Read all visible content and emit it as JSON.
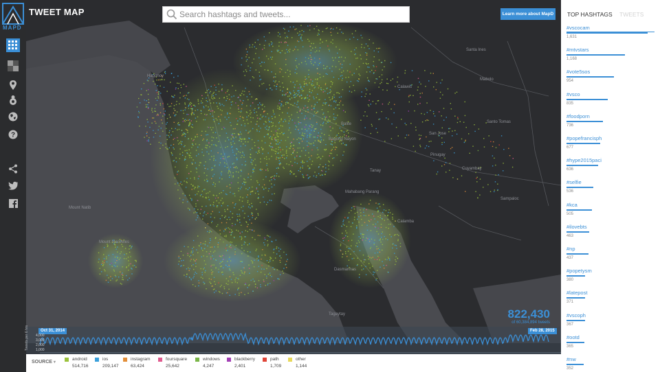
{
  "app": {
    "title": "TWEET MAP",
    "logo_text": "MAPD"
  },
  "search": {
    "placeholder": "Search hashtags and tweets..."
  },
  "header": {
    "learn_more": "Learn more about MapD"
  },
  "sidebar": {
    "icons": [
      "heatmap-icon",
      "layers-icon",
      "map-pin-icon",
      "hashtag-icon",
      "globe-icon",
      "help-icon",
      "share-icon",
      "twitter-icon",
      "facebook-icon"
    ]
  },
  "map": {
    "places": [
      "Santa Ines",
      "Calawis",
      "San Jose",
      "Pinugay",
      "Cuyambay",
      "Mabolo",
      "Sampaloc",
      "Santo Tomas",
      "Balite",
      "Mahabang Parang",
      "Bagong Nayon",
      "Tanay",
      "Mount Mariveles",
      "Mount Natib",
      "Hagonoy",
      "Tagaytay",
      "Dasmarinas",
      "Calamba"
    ],
    "count": "822,430",
    "count_total": "of 60,384,894 tweets"
  },
  "timeline": {
    "start_date": "Oct 31, 2014",
    "end_date": "Feb 28, 2015",
    "y_label": "Tweets per 6 hrs",
    "y_ticks": [
      "4,000",
      "3,000",
      "2,000",
      "1,000"
    ],
    "y_tick_values": [
      4000,
      3000,
      2000,
      1000
    ]
  },
  "legend": {
    "source_label": "SOURCE",
    "items": [
      {
        "label": "android",
        "count": "514,716",
        "color": "#9bc23c"
      },
      {
        "label": "ios",
        "count": "209,147",
        "color": "#3aa0db"
      },
      {
        "label": "instagram",
        "count": "63,424",
        "color": "#e38f3a"
      },
      {
        "label": "foursquare",
        "count": "25,642",
        "color": "#e05a8e"
      },
      {
        "label": "windows",
        "count": "4,247",
        "color": "#7ab648"
      },
      {
        "label": "blackberry",
        "count": "2,401",
        "color": "#a23fb5"
      },
      {
        "label": "path",
        "count": "1,709",
        "color": "#e04438"
      },
      {
        "label": "other",
        "count": "1,144",
        "color": "#e8d85a"
      }
    ]
  },
  "right_panel": {
    "tab_hashtags": "TOP HASHTAGS",
    "tab_tweets": "TWEETS",
    "hashtags": [
      {
        "tag": "#vscocam",
        "count": "1,631",
        "value": 1631
      },
      {
        "tag": "#mtvstars",
        "count": "1,168",
        "value": 1168
      },
      {
        "tag": "#vote5sos",
        "count": "954",
        "value": 954
      },
      {
        "tag": "#vsco",
        "count": "835",
        "value": 835
      },
      {
        "tag": "#foodporn",
        "count": "736",
        "value": 736
      },
      {
        "tag": "#popefrancisph",
        "count": "677",
        "value": 677
      },
      {
        "tag": "#hype2015paci",
        "count": "636",
        "value": 636
      },
      {
        "tag": "#selfie",
        "count": "536",
        "value": 536
      },
      {
        "tag": "#kca",
        "count": "505",
        "value": 505
      },
      {
        "tag": "#ilovebts",
        "count": "463",
        "value": 463
      },
      {
        "tag": "#np",
        "count": "437",
        "value": 437
      },
      {
        "tag": "#popetysm",
        "count": "380",
        "value": 380
      },
      {
        "tag": "#latepost",
        "count": "371",
        "value": 371
      },
      {
        "tag": "#vscoph",
        "count": "367",
        "value": 367
      },
      {
        "tag": "#ootd",
        "count": "365",
        "value": 365
      },
      {
        "tag": "#nw",
        "count": "352",
        "value": 352
      }
    ]
  }
}
